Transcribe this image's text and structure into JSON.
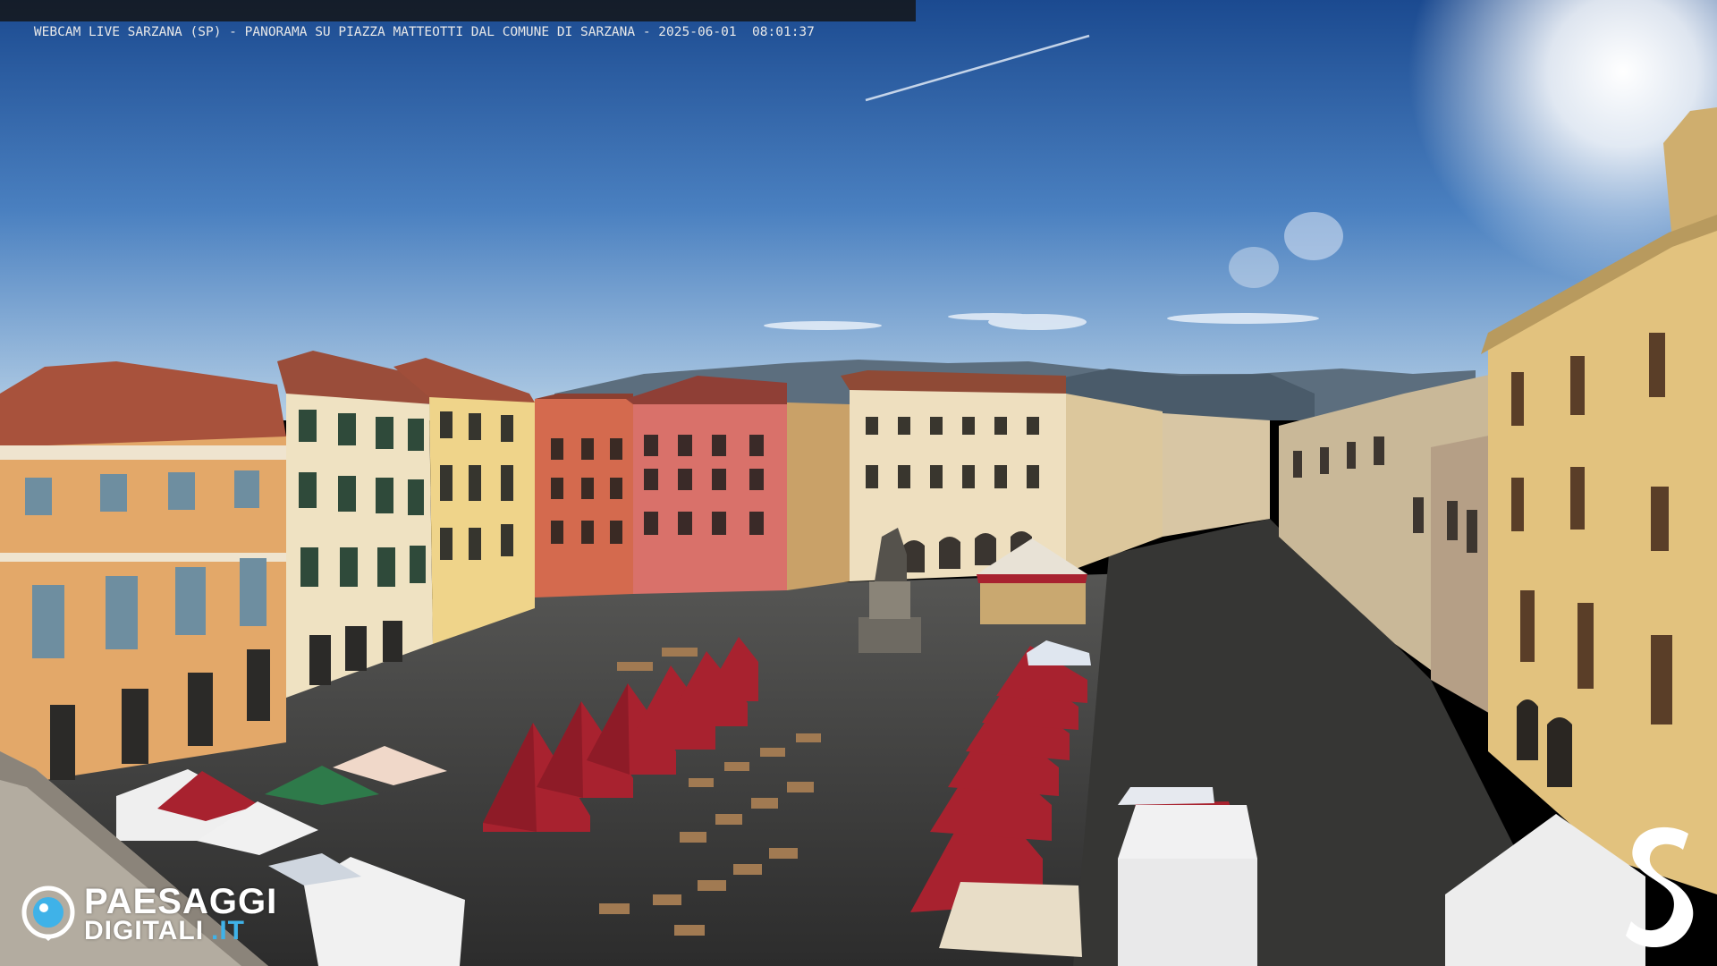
{
  "overlay": {
    "title": "WEBCAM LIVE SARZANA (SP) - PANORAMA SU PIAZZA MATTEOTTI DAL COMUNE DI SARZANA - 2025-06-01  08:01:37"
  },
  "branding": {
    "left_logo_word1": "PAESAGGI",
    "left_logo_word2": "DIGITALI",
    "left_logo_suffix": ".IT",
    "right_logo_letter": "S"
  },
  "colors": {
    "sky_top": "#1e4f95",
    "sky_bottom": "#a9c7e2",
    "tent_red": "#a8222f",
    "tent_white": "#eeeeee",
    "logo_accent": "#3fb2e8"
  }
}
